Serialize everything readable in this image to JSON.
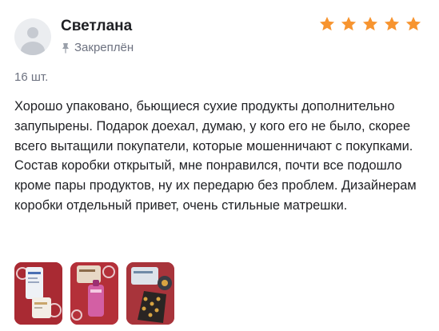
{
  "review": {
    "author": "Светлана",
    "pinned_label": "Закреплён",
    "rating": 5,
    "rating_max": 5,
    "star_color": "#f7942f",
    "quantity": "16 шт.",
    "text": "Хорошо упаковано, бьющиеся сухие продукты дополнительно запупырены. Подарок доехал, думаю, у кого его не было, скорее всего вытащили покупатели, которые мошенничают с покупками. Состав коробки открытый, мне понравился, почти все подошло кроме пары продуктов, ну их передарю без проблем. Дизайнерам коробки отдельный привет, очень стильные матрешки.",
    "photos": [
      {
        "icon": "photo-thumbnail"
      },
      {
        "icon": "photo-thumbnail"
      },
      {
        "icon": "photo-thumbnail"
      }
    ]
  }
}
